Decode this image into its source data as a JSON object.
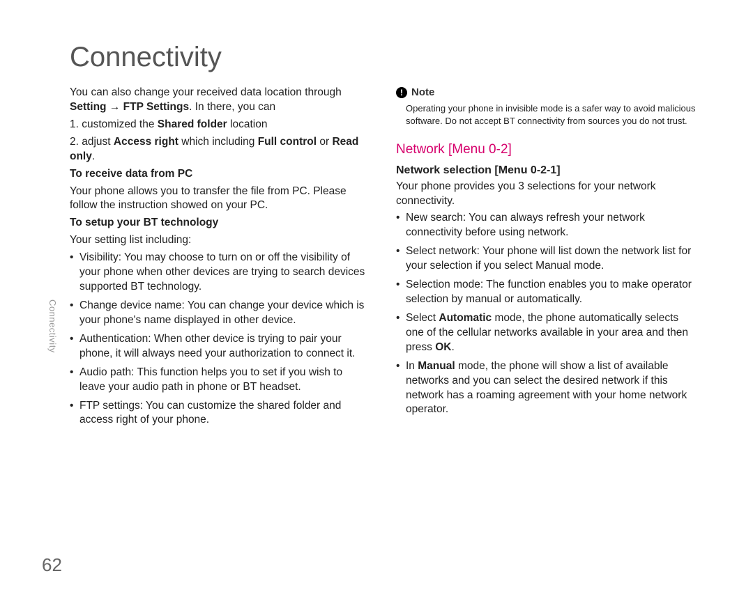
{
  "page": {
    "title": "Connectivity",
    "sideLabel": "Connectivity",
    "number": "62"
  },
  "left": {
    "intro1a": "You can also change your received data location through ",
    "intro1b": "Setting → FTP Settings",
    "intro1c": ". In there, you can",
    "li1a": "1. customized the ",
    "li1b": "Shared folder",
    "li1c": " location",
    "li2a": "2. adjust ",
    "li2b": "Access right",
    "li2c": " which including ",
    "li2d": "Full control",
    "li2e": " or ",
    "li2f": "Read only",
    "li2g": ".",
    "receiveHead": "To receive data from PC",
    "receiveBody": "Your phone allows you to transfer the file from PC. Please follow the instruction showed on your PC.",
    "setupHead": "To setup your BT technology",
    "setupLine": "Your setting list including:",
    "bullets": {
      "b1": "Visibility: You may choose to turn on or off the visibility of your phone when other devices are trying to search devices supported BT technology.",
      "b2": "Change device name: You can change your device which is your phone's name displayed in other device.",
      "b3": "Authentication: When other device is trying to pair your phone, it will always need your authorization to connect it.",
      "b4": "Audio path: This function helps you to set if you wish to leave your audio path in phone or BT headset.",
      "b5": "FTP settings: You can customize the shared folder and access right of your phone."
    }
  },
  "right": {
    "noteLabel": "Note",
    "noteIconGlyph": "!",
    "noteBody": "Operating your phone in invisible mode is a safer way to avoid malicious software. Do not accept BT connectivity from sources you do not trust.",
    "networkHeading": "Network [Menu 0-2]",
    "selectionHeading": "Network selection [Menu 0-2-1]",
    "selectionIntro": "Your phone provides you 3 selections for your network connectivity.",
    "bullets": {
      "n1": "New search: You can always refresh your network connectivity before using network.",
      "n2": "Select network: Your phone will list down the network list for your selection if you select Manual mode.",
      "n3": "Selection mode: The function enables you to make operator selection by manual or automatically.",
      "n4a": "Select ",
      "n4b": "Automatic",
      "n4c": " mode, the phone automatically selects one of the cellular networks available in your area and then press ",
      "n4d": "OK",
      "n4e": ".",
      "n5a": "In ",
      "n5b": "Manual",
      "n5c": " mode, the phone will show a list of available networks and you can select the desired network if this network has a roaming agreement with your home network operator."
    }
  }
}
